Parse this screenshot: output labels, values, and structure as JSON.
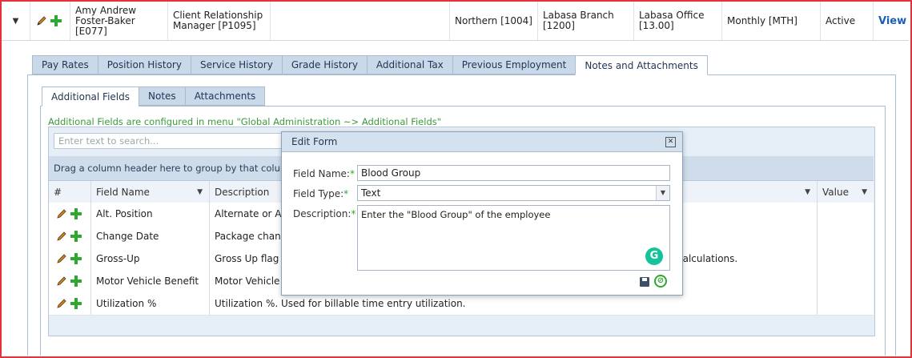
{
  "employee": {
    "name": "Amy Andrew Foster-Baker [E077]",
    "position": "Client Relationship Manager [P1095]",
    "region": "Northern [1004]",
    "branch": "Labasa Branch [1200]",
    "office": "Labasa Office [13.00]",
    "pay_cycle": "Monthly [MTH]",
    "status": "Active",
    "view_label": "View"
  },
  "main_tabs": [
    "Pay Rates",
    "Position History",
    "Service History",
    "Grade History",
    "Additional Tax",
    "Previous Employment",
    "Notes and Attachments"
  ],
  "sub_tabs": [
    "Additional Fields",
    "Notes",
    "Attachments"
  ],
  "info_text": "Additional Fields are configured in menu \"Global Administration ~> Additional Fields\"",
  "grid": {
    "search_placeholder": "Enter text to search...",
    "group_hint": "Drag a column header here to group by that column",
    "columns": {
      "num": "#",
      "field_name": "Field Name",
      "description": "Description",
      "value": "Value"
    },
    "rows": [
      {
        "field_name": "Alt. Position",
        "description": "Alternate or Ac"
      },
      {
        "field_name": "Change Date",
        "description": "Package chang"
      },
      {
        "field_name": "Gross-Up",
        "description": "Gross Up flag f",
        "tail": "calculations."
      },
      {
        "field_name": "Motor Vehicle Benefit",
        "description": "Motor Vehicle B"
      },
      {
        "field_name": "Utilization %",
        "description": "Utilization %. Used for billable time entry utilization."
      }
    ]
  },
  "modal": {
    "title": "Edit Form",
    "field_name_label": "Field Name:",
    "field_type_label": "Field Type:",
    "description_label": "Description:",
    "required_mark": "*",
    "field_name_value": "Blood Group",
    "field_type_value": "Text",
    "description_value": "Enter the \"Blood Group\" of the employee"
  },
  "colors": {
    "border_red": "#e8303a",
    "accent_green": "#2ea82e",
    "tab_blue": "#c9d9ea"
  }
}
